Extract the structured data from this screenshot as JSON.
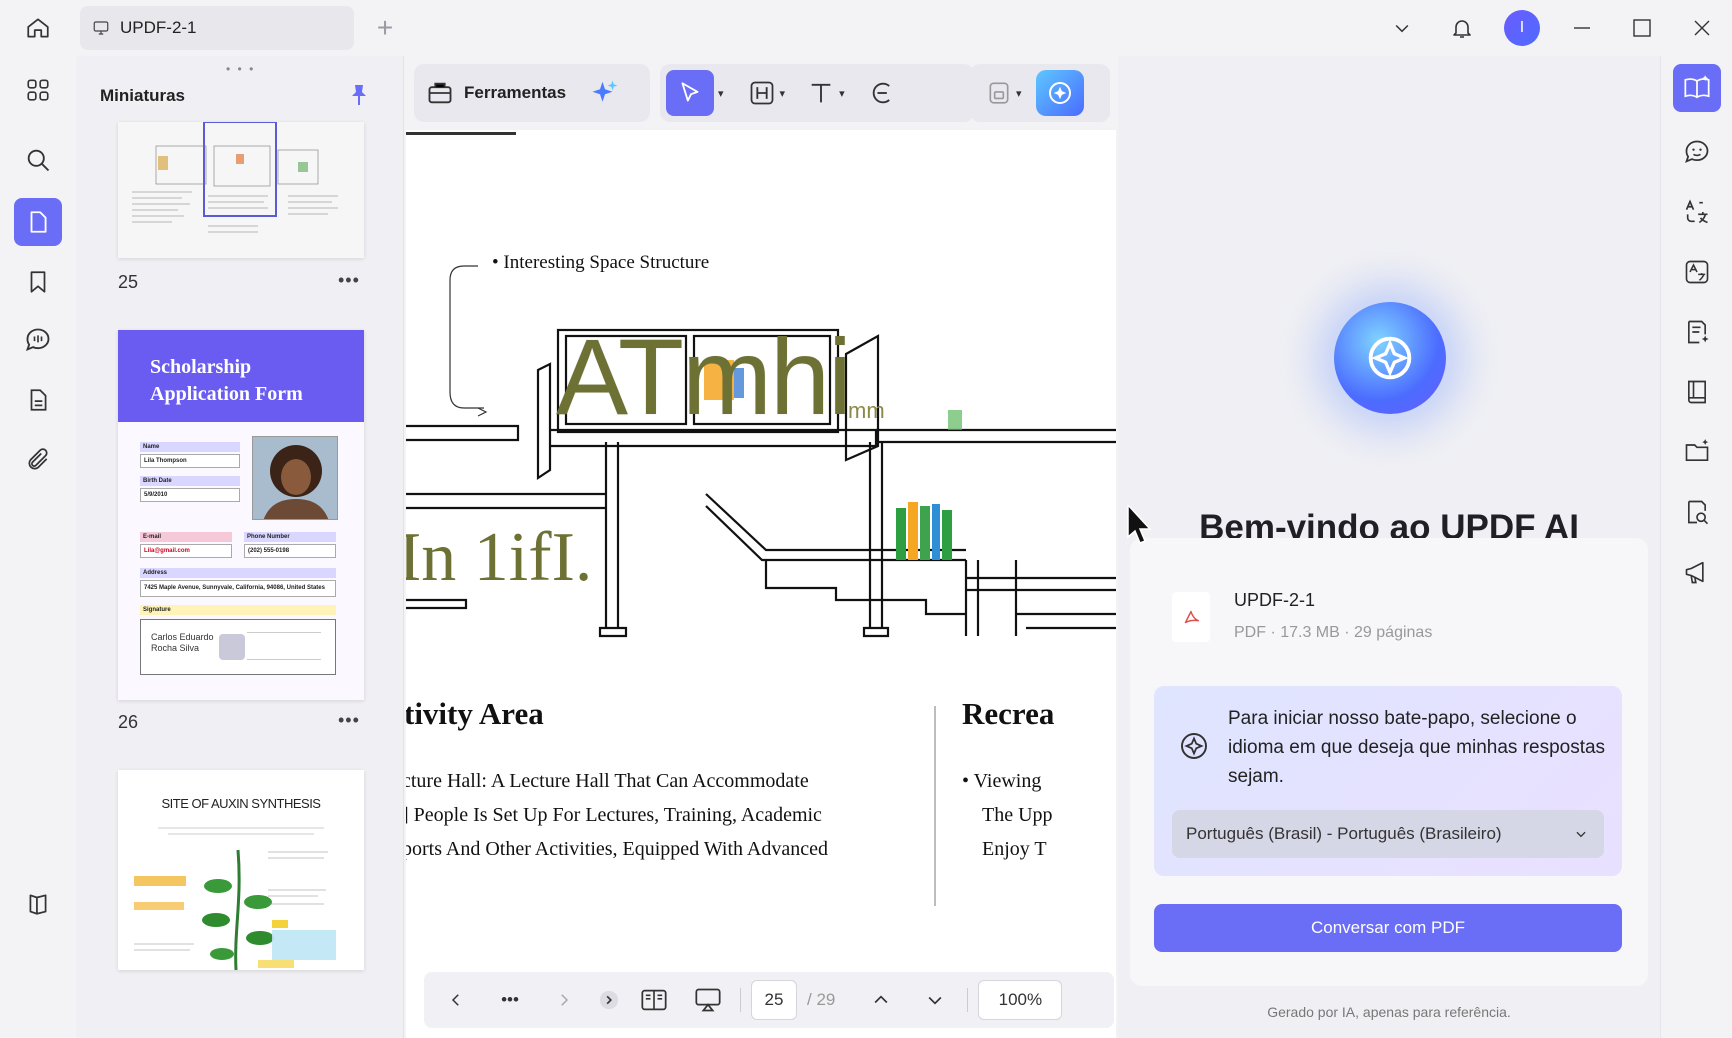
{
  "window": {
    "tab_title": "UPDF-2-1",
    "new_tab": "+",
    "user_initial": "I"
  },
  "thumbnails": {
    "title": "Miniaturas",
    "handle": "• • •",
    "pages": [
      {
        "number": "25",
        "more": "•••"
      },
      {
        "number": "26",
        "more": "•••"
      }
    ],
    "page26": {
      "heading_line1": "Scholarship",
      "heading_line2": "Application Form",
      "name_label": "Name",
      "name_value": "Lila Thompson",
      "birth_label": "Birth Date",
      "birth_value": "5/9/2010",
      "email_label": "E-mail",
      "email_value": "Lila@gmail.com",
      "phone_label": "Phone Number",
      "phone_value": "(202) 555-0198",
      "address_label": "Address",
      "address_value": "7425 Maple Avenue, Sunnyvale, California, 94086, United States",
      "signature_label": "Signature",
      "signature_name": "Carlos Eduardo Rocha Silva"
    },
    "page27": {
      "title": "SITE OF AUXIN SYNTHESIS"
    }
  },
  "toolbar": {
    "tools_label": "Ferramentas"
  },
  "document": {
    "annotation": "• Interesting Space Structure",
    "big_text": "ATmhi",
    "small_text": "mm",
    "lower_text": "In 1ifI.",
    "heading_left": "tivity Area",
    "heading_right": "Recrea",
    "lines_left": [
      "cture Hall: A Lecture Hall That Can Accommodate",
      "] People Is Set Up For Lectures, Training, Academic",
      "ports And Other Activities, Equipped With Advanced"
    ],
    "lines_right": [
      "• Viewing",
      "The Upp",
      "Enjoy T"
    ]
  },
  "pagenav": {
    "more": "•••",
    "current_page": "25",
    "total_pages": "/ 29",
    "zoom": "100%"
  },
  "ai": {
    "welcome": "Bem-vindo ao UPDF AI",
    "file_name": "UPDF-2-1",
    "file_meta": "PDF · 17.3 MB · 29 páginas",
    "prompt": "Para iniciar nosso bate-papo, selecione o idioma em que deseja que minhas respostas sejam.",
    "language": "Português (Brasil) - Português (Brasileiro)",
    "chat_button": "Conversar com PDF",
    "footer": "Gerado por IA, apenas para referência."
  },
  "colors": {
    "accent": "#6a6df5",
    "ai_gradient_start": "#5ec7ff",
    "ai_gradient_end": "#4a6bff",
    "pdf_red": "#e0504a"
  }
}
